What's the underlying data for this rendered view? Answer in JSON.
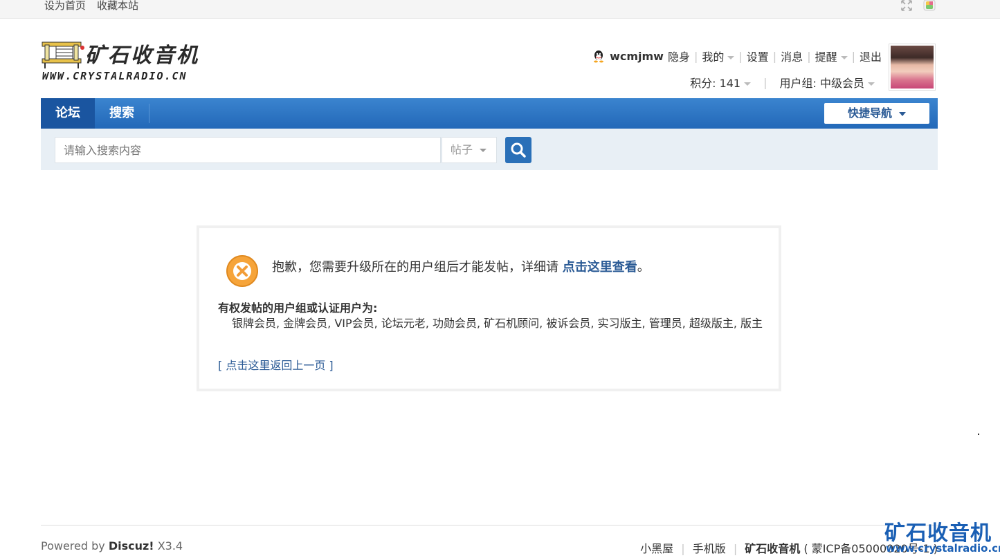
{
  "topbar": {
    "set_home": "设为首页",
    "bookmark": "收藏本站"
  },
  "logo": {
    "cn_text": "矿石收音机",
    "en_text": "WWW.CRYSTALRADIO.CN"
  },
  "user": {
    "username": "wcmjmw",
    "stealth": "隐身",
    "mine": "我的",
    "settings": "设置",
    "messages": "消息",
    "reminders": "提醒",
    "logout": "退出",
    "points": "积分: 141",
    "usergroup": "用户组: 中级会员"
  },
  "nav": {
    "tabs": [
      {
        "label": "论坛",
        "active": true
      },
      {
        "label": "搜索",
        "active": false
      }
    ],
    "quicknav": "快捷导航"
  },
  "search": {
    "placeholder": "请输入搜索内容",
    "type": "帖子"
  },
  "message": {
    "text_before": "抱歉，您需要升级所在的用户组后才能发帖，详细请 ",
    "link": "点击这里查看",
    "text_after": "。",
    "perm_title": "有权发帖的用户组或认证用户为:",
    "perm_list": "银牌会员, 金牌会员, VIP会员, 论坛元老, 功勋会员, 矿石机顾问, 被诉会员, 实习版主, 管理员, 超级版主, 版主",
    "back": "[ 点击这里返回上一页 ]"
  },
  "footer": {
    "powered_prefix": "Powered by ",
    "powered_brand": "Discuz!",
    "powered_version": " X3.4",
    "links": [
      "小黑屋",
      "手机版"
    ],
    "site": "矿石收音机",
    "icp": "( 蒙ICP备05000020号-1 )"
  },
  "watermark": {
    "cn": "矿石收音机",
    "url": "www.crystalradio.cn"
  },
  "colors": {
    "nav": "#2268b8",
    "link": "#2a5a95",
    "error_icon": "#f29d38"
  },
  "icons": {
    "qq": "qq-penguin-icon",
    "search": "magnifier-icon",
    "error": "error-x-icon",
    "fullscreen": "expand-icon",
    "theme": "palette-icon"
  }
}
